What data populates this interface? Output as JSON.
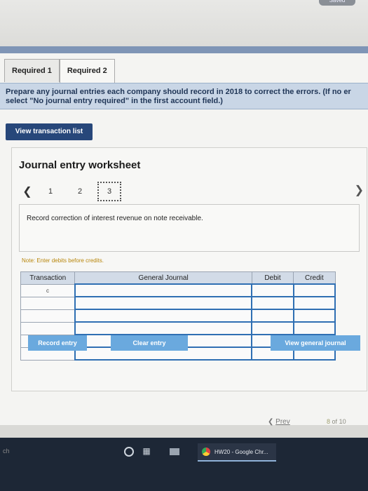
{
  "header": {
    "saved_badge": "Saved"
  },
  "tabs": [
    {
      "label": "Required 1",
      "active": false
    },
    {
      "label": "Required 2",
      "active": true
    }
  ],
  "instruction": {
    "line1": "Prepare any journal entries each company should record in 2018 to correct the errors. (If no er",
    "line2": "select \"No journal entry required\" in the first account field.)"
  },
  "view_transaction_list_label": "View transaction list",
  "worksheet": {
    "title": "Journal entry worksheet",
    "pages": [
      "1",
      "2",
      "3"
    ],
    "current_page": "3",
    "prompt": "Record correction of interest revenue on note receivable.",
    "note": "Note: Enter debits before credits.",
    "table": {
      "headers": [
        "Transaction",
        "General Journal",
        "Debit",
        "Credit"
      ],
      "rows": [
        {
          "transaction": "c",
          "account": "",
          "debit": "",
          "credit": ""
        },
        {
          "transaction": "",
          "account": "",
          "debit": "",
          "credit": ""
        },
        {
          "transaction": "",
          "account": "",
          "debit": "",
          "credit": ""
        },
        {
          "transaction": "",
          "account": "",
          "debit": "",
          "credit": ""
        },
        {
          "transaction": "",
          "account": "",
          "debit": "",
          "credit": ""
        },
        {
          "transaction": "",
          "account": "",
          "debit": "",
          "credit": ""
        }
      ]
    },
    "buttons": {
      "record": "Record entry",
      "clear": "Clear entry",
      "view_journal": "View general journal"
    }
  },
  "navigation": {
    "prev_label": "Prev",
    "current": "8",
    "of": "of",
    "total": "10"
  },
  "taskbar": {
    "left_text": "ch",
    "chrome_label": "HW20 - Google Chr..."
  },
  "colors": {
    "primary_button": "#27477a",
    "secondary_button": "#6aa9de",
    "instruction_bg": "#c9d6e6",
    "taskbar": "#1d2736"
  }
}
